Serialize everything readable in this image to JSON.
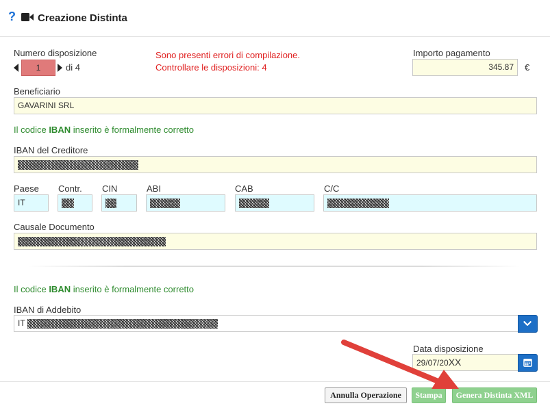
{
  "header": {
    "title": "Creazione Distinta",
    "help_icon": "?"
  },
  "disposition": {
    "label": "Numero disposizione",
    "current": "1",
    "of_text": "di 4"
  },
  "errors": {
    "line1": "Sono presenti errori di compilazione.",
    "line2": "Controllare le disposizioni: 4"
  },
  "payment": {
    "label": "Importo pagamento",
    "value": "345.87",
    "currency": "€"
  },
  "beneficiary": {
    "label": "Beneficiario",
    "value": "GAVARINI SRL"
  },
  "iban_check_1": {
    "prefix": "Il codice ",
    "bold": "IBAN",
    "suffix": " inserito è formalmente corretto"
  },
  "creditor_iban": {
    "label": "IBAN del Creditore"
  },
  "iban_parts": {
    "paese_label": "Paese",
    "paese_value": "IT",
    "contr_label": "Contr.",
    "cin_label": "CIN",
    "abi_label": "ABI",
    "cab_label": "CAB",
    "cc_label": "C/C"
  },
  "causale": {
    "label": "Causale Documento"
  },
  "iban_check_2": {
    "prefix": "Il codice ",
    "bold": "IBAN",
    "suffix": " inserito è formalmente corretto"
  },
  "debit_iban": {
    "label": "IBAN di Addebito",
    "prefix": "IT"
  },
  "date": {
    "label": "Data disposizione",
    "value": "29/07/20",
    "value_suffix": "XX"
  },
  "buttons": {
    "cancel": "Annulla Operazione",
    "print": "Stampa",
    "generate": "Genera Distinta XML"
  },
  "colors": {
    "error": "#e02020",
    "success": "#2e8b2e",
    "primary": "#1d6fc6",
    "input_yellow": "#fdfde3",
    "input_cyan": "#dffbff",
    "button_green": "#8fd18f",
    "annotation_arrow": "#e0403a"
  }
}
